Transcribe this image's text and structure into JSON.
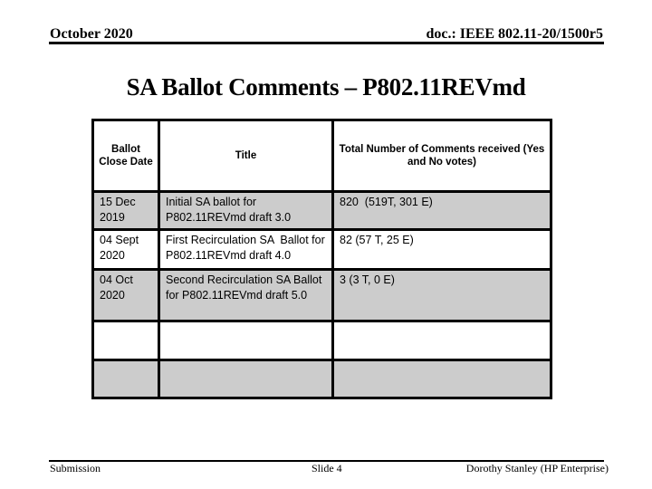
{
  "header": {
    "date": "October 2020",
    "doc_id": "doc.: IEEE 802.11-20/1500r5"
  },
  "slide": {
    "title": "SA Ballot Comments – P802.11REVmd"
  },
  "table": {
    "columns": [
      "Ballot Close Date",
      "Title",
      "Total Number of Comments received (Yes and No votes)"
    ],
    "rows": [
      {
        "date": "15 Dec 2019",
        "title": "Initial SA ballot for P802.11REVmd draft 3.0",
        "comments": "820  (519T, 301 E)"
      },
      {
        "date": "04 Sept 2020",
        "title": "First Recirculation SA  Ballot for P802.11REVmd draft 4.0",
        "comments": "82 (57 T, 25 E)"
      },
      {
        "date": "04 Oct 2020",
        "title": "Second Recirculation SA Ballot for P802.11REVmd draft 5.0",
        "comments": "3 (3 T, 0 E)"
      },
      {
        "date": "",
        "title": "",
        "comments": ""
      },
      {
        "date": "",
        "title": "",
        "comments": ""
      }
    ],
    "colors": {
      "shaded_row": "#cccccc",
      "plain_row": "#ffffff",
      "border": "#000000"
    }
  },
  "footer": {
    "left": "Submission",
    "center": "Slide 4",
    "right": "Dorothy Stanley (HP Enterprise)"
  }
}
